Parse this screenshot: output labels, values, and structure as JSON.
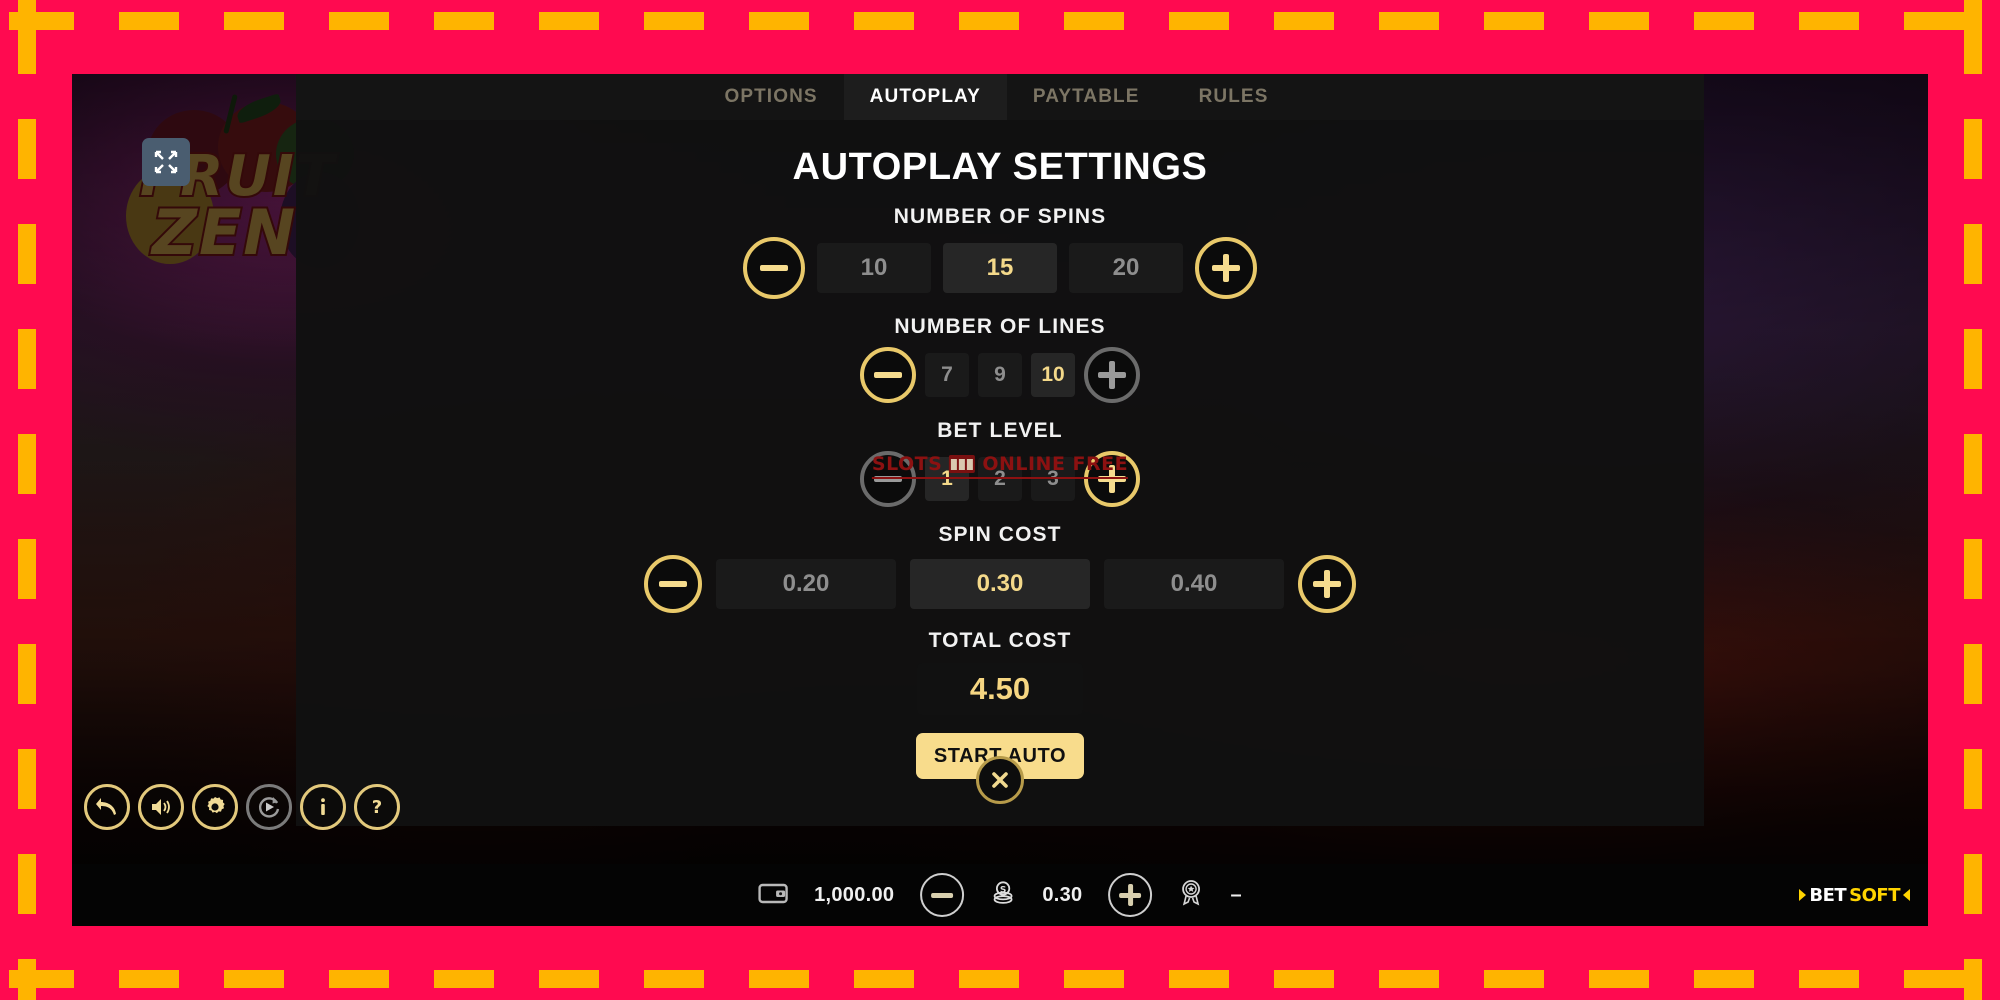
{
  "window": {
    "game_title_line1": "FRUIT",
    "game_title_line2": "ZEN",
    "collapse_icon": "collapse-fullscreen-icon"
  },
  "tabs": [
    {
      "label": "OPTIONS",
      "active": false
    },
    {
      "label": "AUTOPLAY",
      "active": true
    },
    {
      "label": "PAYTABLE",
      "active": false
    },
    {
      "label": "RULES",
      "active": false
    }
  ],
  "panel": {
    "title": "AUTOPLAY SETTINGS",
    "fields": {
      "spins": {
        "label": "NUMBER OF SPINS",
        "options": [
          "10",
          "15",
          "20"
        ],
        "selected": "15",
        "minus_enabled": true,
        "plus_enabled": true
      },
      "lines": {
        "label": "NUMBER OF LINES",
        "options": [
          "7",
          "9",
          "10"
        ],
        "selected": "10",
        "minus_enabled": true,
        "plus_enabled": false
      },
      "bet_level": {
        "label": "BET LEVEL",
        "options": [
          "1",
          "2",
          "3"
        ],
        "selected": "1",
        "minus_enabled": false,
        "plus_enabled": true
      },
      "spin_cost": {
        "label": "SPIN COST",
        "options": [
          "0.20",
          "0.30",
          "0.40"
        ],
        "selected": "0.30",
        "minus_enabled": true,
        "plus_enabled": true
      },
      "total_cost": {
        "label": "TOTAL COST",
        "value": "4.50"
      }
    },
    "start_button": "START AUTO",
    "close_icon": "close-x-icon"
  },
  "watermark": {
    "text_left": "SLOTS",
    "text_right": "ONLINE FREE",
    "color": "#8c1111"
  },
  "tool_icons": [
    {
      "name": "back-arrow-icon",
      "glyph": "↩",
      "enabled": true
    },
    {
      "name": "sound-icon",
      "glyph": "🔊",
      "enabled": true
    },
    {
      "name": "settings-gear-icon",
      "glyph": "⚙",
      "enabled": true
    },
    {
      "name": "autoplay-icon",
      "glyph": "▶",
      "enabled": false
    },
    {
      "name": "info-icon",
      "glyph": "i",
      "enabled": true
    },
    {
      "name": "help-icon",
      "glyph": "?",
      "enabled": true
    }
  ],
  "bottom_bar": {
    "wallet_icon": "wallet-icon",
    "balance": "1,000.00",
    "decrease_icon": "minus-icon",
    "coins_icon": "coin-stack-icon",
    "bet": "0.30",
    "increase_icon": "plus-icon",
    "award_icon": "award-medal-icon",
    "win": "–",
    "brand_white": "BET",
    "brand_yellow": "SOFT"
  },
  "colors": {
    "frame_pink": "#ff0a50",
    "frame_dash": "#ffb400",
    "gold": "#e9c96a",
    "gold_text": "#f6d682",
    "button_bg": "#f8dc8c",
    "panel_bg": "#111111"
  }
}
